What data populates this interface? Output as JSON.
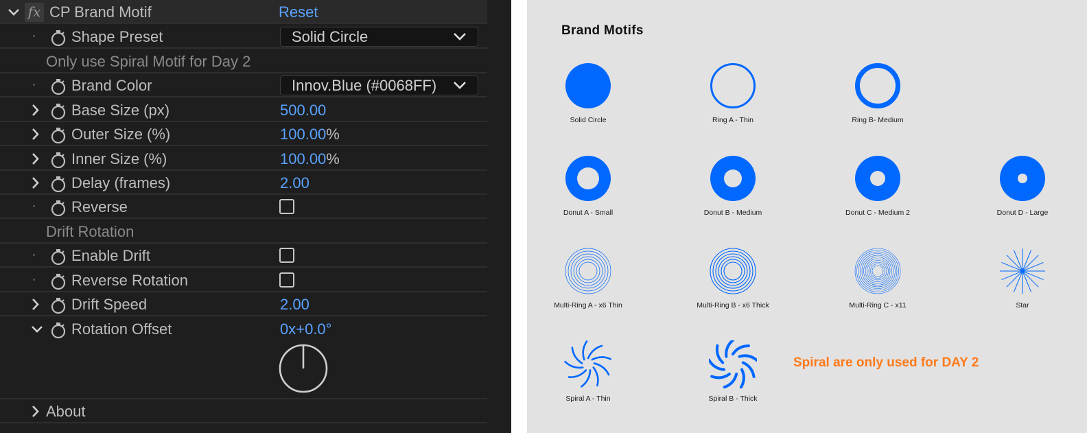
{
  "effect_panel": {
    "effect_name": "CP Brand Motif",
    "reset_label": "Reset",
    "shape_preset": {
      "label": "Shape Preset",
      "value": "Solid Circle"
    },
    "note_spiral": "Only use Spiral Motif for Day 2",
    "brand_color": {
      "label": "Brand Color",
      "value": "Innov.Blue (#0068FF)"
    },
    "base_size": {
      "label": "Base Size (px)",
      "value": "500.00"
    },
    "outer_size": {
      "label": "Outer Size (%)",
      "value": "100.00",
      "unit": "%"
    },
    "inner_size": {
      "label": "Inner Size (%)",
      "value": "100.00",
      "unit": "%"
    },
    "delay": {
      "label": "Delay (frames)",
      "value": "2.00"
    },
    "reverse": {
      "label": "Reverse",
      "checked": false
    },
    "drift_rotation_heading": "Drift Rotation",
    "enable_drift": {
      "label": "Enable Drift",
      "checked": false
    },
    "reverse_rotation": {
      "label": "Reverse Rotation",
      "checked": false
    },
    "drift_speed": {
      "label": "Drift Speed",
      "value": "2.00"
    },
    "rotation_offset": {
      "label": "Rotation Offset",
      "value": "0x+0.0°"
    },
    "about_label": "About"
  },
  "motifs_sheet": {
    "title": "Brand Motifs",
    "brand_color": "#0068FF",
    "note_color": "#FF7A1A",
    "items": [
      {
        "name": "Solid Circle"
      },
      {
        "name": "Ring A - Thin"
      },
      {
        "name": "Ring B- Medium"
      },
      {
        "name": "Donut A - Small"
      },
      {
        "name": "Donut B - Medium"
      },
      {
        "name": "Donut C - Medium 2"
      },
      {
        "name": "Donut D - Large"
      },
      {
        "name": "Multi-Ring A - x6 Thin"
      },
      {
        "name": "Multi-Ring B - x6 Thick"
      },
      {
        "name": "Multi-Ring C - x11"
      },
      {
        "name": "Star"
      },
      {
        "name": "Spiral A - Thin"
      },
      {
        "name": "Spiral B - Thick"
      }
    ],
    "note": "Spiral are only used for DAY 2"
  }
}
